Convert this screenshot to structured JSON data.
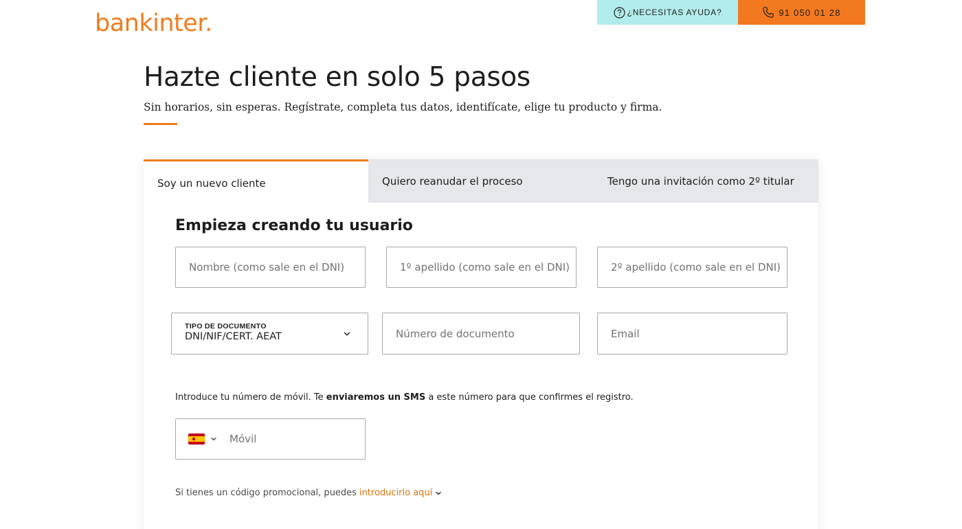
{
  "header": {
    "logo_text": "bankinter.",
    "help_label": "¿NECESITAS AYUDA?",
    "help_icon": "question-circle-icon",
    "phone_label": "91 050 01 28",
    "phone_icon": "phone-icon",
    "brand_color": "#f07c1b",
    "help_bg": "#b3ecec",
    "phone_bg": "#f37920"
  },
  "hero": {
    "title": "Hazte cliente en solo 5 pasos",
    "subtitle": "Sin horarios, sin esperas. Regístrate, completa tus datos, identifícate, elige tu producto y firma."
  },
  "tabs": [
    {
      "label": "Soy un nuevo cliente",
      "active": true
    },
    {
      "label": "Quiero reanudar el proceso",
      "active": false
    },
    {
      "label": "Tengo una invitación como 2º titular",
      "active": false
    }
  ],
  "form": {
    "section_title": "Empieza creando tu usuario",
    "nombre_placeholder": "Nombre (como sale en el DNI)",
    "apellido1_placeholder": "1º apellido (como sale en el DNI)",
    "apellido2_placeholder": "2º apellido (como sale en el DNI)",
    "doc_type_caption": "TIPO DE DOCUMENTO",
    "doc_type_value": "DNI/NIF/CERT. AEAT",
    "doc_number_placeholder": "Número de documento",
    "email_placeholder": "Email",
    "sms_text_before": "Introduce tu número de móvil. Te ",
    "sms_text_bold": "enviaremos un SMS",
    "sms_text_after": " a este número para que confirmes el registro.",
    "country_flag": "spain-flag-icon",
    "mobile_placeholder": "Móvil",
    "promo_text": "Si tienes un código promocional, puedes ",
    "promo_link": "introducirlo aquí"
  }
}
